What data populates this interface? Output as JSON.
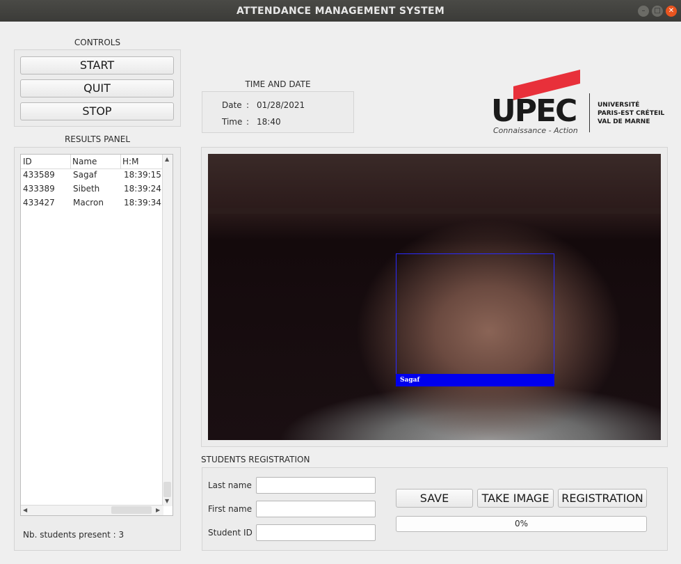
{
  "window": {
    "title": "ATTENDANCE MANAGEMENT SYSTEM"
  },
  "controls": {
    "label": "CONTROLS",
    "start": "START",
    "quit": "QUIT",
    "stop": "STOP"
  },
  "results": {
    "label": "RESULTS PANEL",
    "columns": [
      "ID",
      "Name",
      "H:M"
    ],
    "rows": [
      {
        "id": "433589",
        "name": "Sagaf",
        "time": "18:39:15"
      },
      {
        "id": "433389",
        "name": "Sibeth",
        "time": "18:39:24"
      },
      {
        "id": "433427",
        "name": "Macron",
        "time": "18:39:34"
      }
    ],
    "count_text": "Nb. students present : 3"
  },
  "timedate": {
    "label": "TIME AND DATE",
    "date_label": "Date",
    "date_value": "01/28/2021",
    "time_label": "Time",
    "time_value": "18:40",
    "separator": ":"
  },
  "logo": {
    "mark": "UPEC",
    "tagline": "Connaissance - Action",
    "line1": "UNIVERSITÉ",
    "line2": "PARIS-EST CRÉTEIL",
    "line3": "VAL DE MARNE",
    "accent_color": "#e8303a"
  },
  "camera": {
    "detected_name": "Sagaf",
    "box_color": "#0000ee"
  },
  "registration": {
    "label": "STUDENTS REGISTRATION",
    "last_name_label": "Last name",
    "first_name_label": "First name",
    "student_id_label": "Student ID",
    "last_name_value": "",
    "first_name_value": "",
    "student_id_value": "",
    "save": "SAVE",
    "take_image": "TAKE IMAGE",
    "registration": "REGISTRATION",
    "progress": 0,
    "progress_text": "0%"
  },
  "icons": {
    "minimize": "minimize-icon",
    "maximize": "maximize-icon",
    "close": "close-icon"
  }
}
